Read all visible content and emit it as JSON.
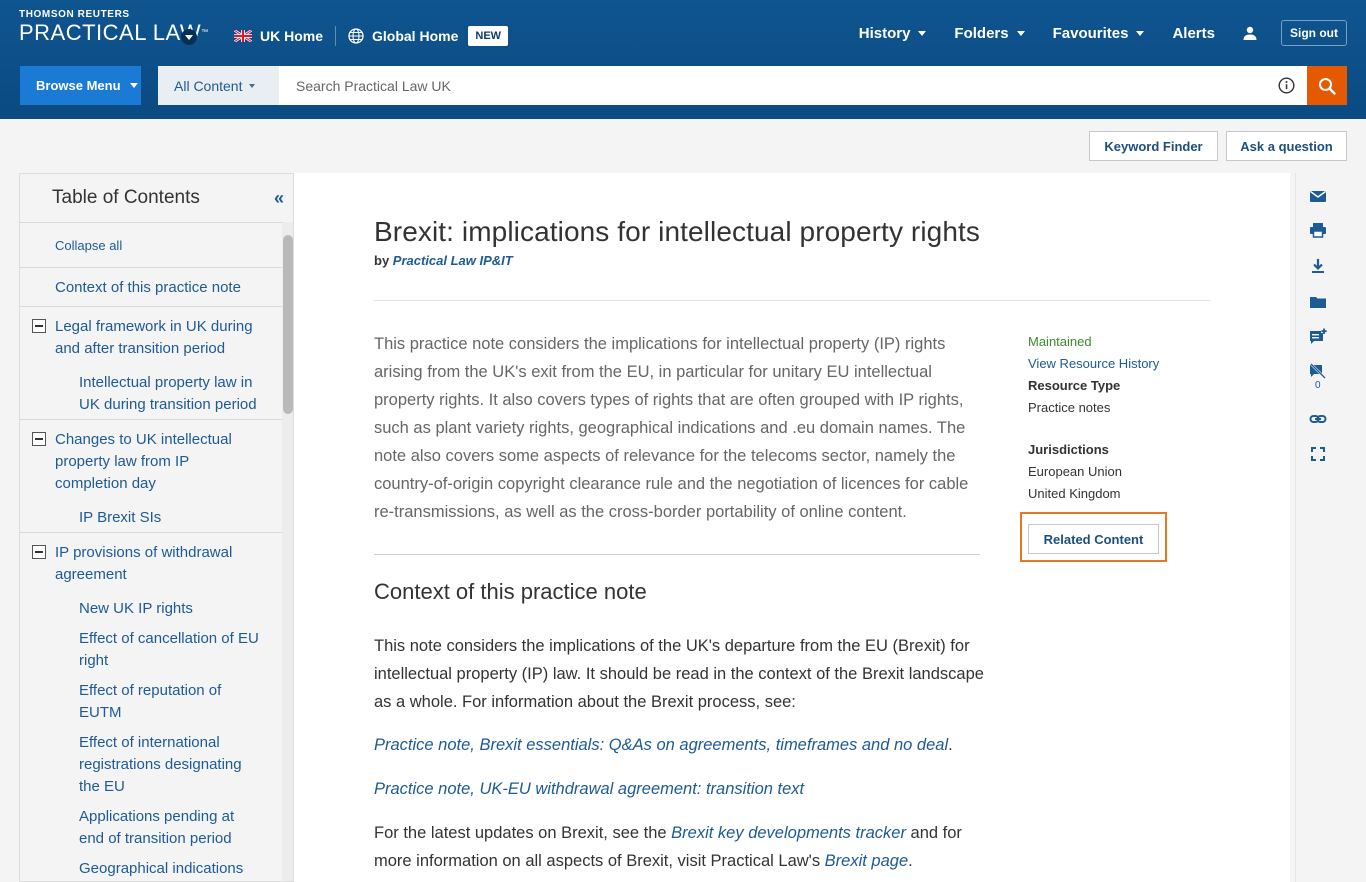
{
  "header": {
    "brand_small": "THOMSON REUTERS",
    "brand_big": "PRACTICAL LAW",
    "brand_tm": "™",
    "uk_home": "UK Home",
    "global_home": "Global Home",
    "new_badge": "NEW",
    "nav": {
      "history": "History",
      "folders": "Folders",
      "favourites": "Favourites",
      "alerts": "Alerts",
      "sign_out": "Sign out"
    }
  },
  "search": {
    "browse_menu": "Browse Menu",
    "scope": "All Content",
    "placeholder": "Search Practical Law UK"
  },
  "toolbar": {
    "keyword_finder": "Keyword Finder",
    "ask_question": "Ask a question"
  },
  "toc": {
    "title": "Table of Contents",
    "collapse_icon": "«",
    "collapse_all": "Collapse all",
    "items": [
      "Context of this practice note",
      "Legal framework in UK during and after transition period",
      "Intellectual property law in UK during transition period",
      "Changes to UK intellectual property law from IP completion day",
      "IP Brexit SIs",
      "IP provisions of withdrawal agreement",
      "New UK IP rights",
      "Effect of cancellation of EU right",
      "Effect of reputation of EUTM",
      "Effect of international registrations designating the EU",
      "Applications pending at end of transition period",
      "Geographical indications"
    ]
  },
  "article": {
    "title": "Brexit: implications for intellectual property rights",
    "by": "by",
    "author": "Practical Law IP&IT",
    "abstract": "This practice note considers the implications for intellectual property (IP) rights arising from the UK's exit from the EU, in particular for unitary EU intellectual property rights. It also covers types of rights that are often grouped with IP rights, such as plant variety rights, geographical indications and .eu domain names. The note also covers some aspects of relevance for the telecoms sector, namely the country-of-origin copyright clearance rule and the negotiation of licences for cable re-transmissions, as well as the cross-border portability of online content.",
    "section_heading": "Context of this practice note",
    "para1": "This note considers the implications of the UK's departure from the EU (Brexit) for intellectual property (IP) law. It should be read in the context of the Brexit landscape as a whole. For information about the Brexit process, see:",
    "link1": "Practice note, Brexit essentials: Q&As on agreements, timeframes and no deal",
    "link1_tail": ".",
    "link2": "Practice note, UK-EU withdrawal agreement: transition text",
    "para3_a": "For the latest updates on Brexit, see the ",
    "para3_link1": "Brexit key developments tracker",
    "para3_b": " and for more information on all aspects of Brexit, visit Practical Law's ",
    "para3_link2": "Brexit page",
    "para3_c": "."
  },
  "meta": {
    "status": "Maintained",
    "history_link": "View Resource History",
    "resource_type_label": "Resource Type",
    "resource_type": "Practice notes",
    "jurisdictions_label": "Jurisdictions",
    "jurisdictions": [
      "European Union",
      "United Kingdom"
    ],
    "related_button": "Related Content"
  },
  "rail": {
    "icons": [
      "email-icon",
      "print-icon",
      "download-icon",
      "folder-icon",
      "add-note-icon",
      "annotations-icon",
      "link-icon",
      "fullscreen-icon"
    ],
    "annotation_count": "0"
  },
  "colors": {
    "header_blue": "#0b4a82",
    "browse_blue": "#1a7ad4",
    "search_orange": "#e55a00",
    "link_blue": "#1d5a96",
    "highlight_orange": "#e87722",
    "maintained_green": "#3a8a2e"
  }
}
